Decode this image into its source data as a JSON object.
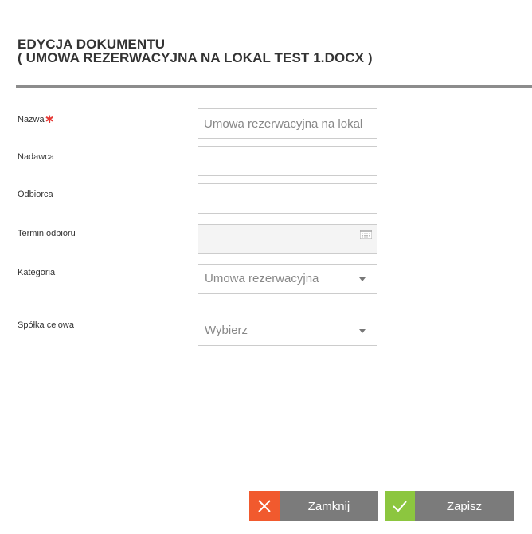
{
  "dialog": {
    "title_line1": "EDYCJA DOKUMENTU",
    "title_line2": "( UMOWA REZERWACYJNA NA LOKAL TEST 1.DOCX )"
  },
  "form": {
    "name": {
      "label": "Nazwa",
      "required_mark": "✱",
      "value": "Umowa rezerwacyjna na lokal"
    },
    "sender": {
      "label": "Nadawca",
      "value": ""
    },
    "recipient": {
      "label": "Odbiorca",
      "value": ""
    },
    "pickup_date": {
      "label": "Termin odbioru",
      "value": "",
      "icon": "calendar-icon"
    },
    "category": {
      "label": "Kategoria",
      "selected": "Umowa rezerwacyjna",
      "icon": "chevron-down-icon"
    },
    "spv": {
      "label": "Spółka celowa",
      "selected": "Wybierz",
      "icon": "chevron-down-icon"
    }
  },
  "actions": {
    "close_label": "Zamknij",
    "close_icon": "close-icon",
    "save_label": "Zapisz",
    "save_icon": "check-icon"
  },
  "colors": {
    "close_accent": "#f15a2e",
    "save_accent": "#8cc63f",
    "button_bg": "#7b7b7b",
    "required": "#e53935"
  }
}
